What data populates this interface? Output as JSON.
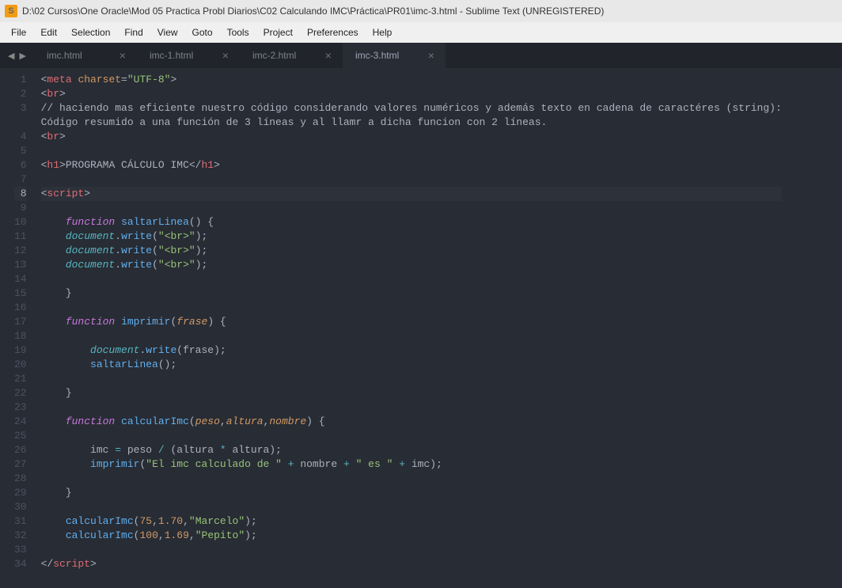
{
  "title": "D:\\02 Cursos\\One Oracle\\Mod 05 Practica Probl Diarios\\C02 Calculando IMC\\Práctica\\PR01\\imc-3.html - Sublime Text (UNREGISTERED)",
  "menu": [
    "File",
    "Edit",
    "Selection",
    "Find",
    "View",
    "Goto",
    "Tools",
    "Project",
    "Preferences",
    "Help"
  ],
  "nav": {
    "back": "◀",
    "forward": "▶"
  },
  "tabs": [
    {
      "label": "imc.html",
      "active": false
    },
    {
      "label": "imc-1.html",
      "active": false
    },
    {
      "label": "imc-2.html",
      "active": false
    },
    {
      "label": "imc-3.html",
      "active": true
    }
  ],
  "close_glyph": "×",
  "active_line": 8,
  "code": [
    {
      "n": 1,
      "seg": [
        [
          "<",
          "p-grey"
        ],
        [
          "meta ",
          "p-red"
        ],
        [
          "charset",
          "p-orange"
        ],
        [
          "=",
          "p-grey"
        ],
        [
          "\"UTF-8\"",
          "p-green"
        ],
        [
          ">",
          "p-grey"
        ]
      ]
    },
    {
      "n": 2,
      "seg": [
        [
          "<",
          "p-grey"
        ],
        [
          "br",
          "p-red"
        ],
        [
          ">",
          "p-grey"
        ]
      ]
    },
    {
      "n": 3,
      "seg": [
        [
          "// haciendo mas eficiente nuestro código considerando valores numéricos y además texto en cadena de caractéres (string):",
          "p-grey"
        ]
      ]
    },
    {
      "n": 0,
      "seg": [
        [
          "Código resumido a una función de 3 líneas y al llamr a dicha funcion con 2 líneas.",
          "p-grey"
        ]
      ]
    },
    {
      "n": 4,
      "seg": [
        [
          "<",
          "p-grey"
        ],
        [
          "br",
          "p-red"
        ],
        [
          ">",
          "p-grey"
        ]
      ]
    },
    {
      "n": 5,
      "seg": [
        [
          "",
          "p-grey"
        ]
      ]
    },
    {
      "n": 6,
      "seg": [
        [
          "<",
          "p-grey"
        ],
        [
          "h1",
          "p-red"
        ],
        [
          ">",
          "p-grey"
        ],
        [
          "PROGRAMA CÁLCULO IMC",
          "p-grey"
        ],
        [
          "</",
          "p-grey"
        ],
        [
          "h1",
          "p-red"
        ],
        [
          ">",
          "p-grey"
        ]
      ]
    },
    {
      "n": 7,
      "seg": [
        [
          "",
          "p-grey"
        ]
      ]
    },
    {
      "n": 8,
      "seg": [
        [
          "<",
          "p-grey"
        ],
        [
          "script",
          "p-red"
        ],
        [
          ">",
          "p-grey"
        ]
      ]
    },
    {
      "n": 9,
      "seg": [
        [
          "",
          "p-grey"
        ]
      ]
    },
    {
      "n": 10,
      "seg": [
        [
          "    ",
          "p-grey"
        ],
        [
          "function",
          "p-purple p-ital"
        ],
        [
          " ",
          "p-grey"
        ],
        [
          "saltarLinea",
          "p-blue"
        ],
        [
          "() {",
          "p-grey"
        ]
      ]
    },
    {
      "n": 11,
      "seg": [
        [
          "    ",
          "p-grey"
        ],
        [
          "document",
          "p-cyan p-ital"
        ],
        [
          ".",
          "p-grey"
        ],
        [
          "write",
          "p-blue"
        ],
        [
          "(",
          "p-grey"
        ],
        [
          "\"<br>\"",
          "p-green"
        ],
        [
          ");",
          "p-grey"
        ]
      ]
    },
    {
      "n": 12,
      "seg": [
        [
          "    ",
          "p-grey"
        ],
        [
          "document",
          "p-cyan p-ital"
        ],
        [
          ".",
          "p-grey"
        ],
        [
          "write",
          "p-blue"
        ],
        [
          "(",
          "p-grey"
        ],
        [
          "\"<br>\"",
          "p-green"
        ],
        [
          ");",
          "p-grey"
        ]
      ]
    },
    {
      "n": 13,
      "seg": [
        [
          "    ",
          "p-grey"
        ],
        [
          "document",
          "p-cyan p-ital"
        ],
        [
          ".",
          "p-grey"
        ],
        [
          "write",
          "p-blue"
        ],
        [
          "(",
          "p-grey"
        ],
        [
          "\"<br>\"",
          "p-green"
        ],
        [
          ");",
          "p-grey"
        ]
      ]
    },
    {
      "n": 14,
      "seg": [
        [
          "",
          "p-grey"
        ]
      ]
    },
    {
      "n": 15,
      "seg": [
        [
          "    }",
          "p-grey"
        ]
      ]
    },
    {
      "n": 16,
      "seg": [
        [
          "",
          "p-grey"
        ]
      ]
    },
    {
      "n": 17,
      "seg": [
        [
          "    ",
          "p-grey"
        ],
        [
          "function",
          "p-purple p-ital"
        ],
        [
          " ",
          "p-grey"
        ],
        [
          "imprimir",
          "p-blue"
        ],
        [
          "(",
          "p-grey"
        ],
        [
          "frase",
          "p-orange p-ital"
        ],
        [
          ") {",
          "p-grey"
        ]
      ]
    },
    {
      "n": 18,
      "seg": [
        [
          "",
          "p-grey"
        ]
      ]
    },
    {
      "n": 19,
      "seg": [
        [
          "        ",
          "p-grey"
        ],
        [
          "document",
          "p-cyan p-ital"
        ],
        [
          ".",
          "p-grey"
        ],
        [
          "write",
          "p-blue"
        ],
        [
          "(frase);",
          "p-grey"
        ]
      ]
    },
    {
      "n": 20,
      "seg": [
        [
          "        ",
          "p-grey"
        ],
        [
          "saltarLinea",
          "p-blue"
        ],
        [
          "();",
          "p-grey"
        ]
      ]
    },
    {
      "n": 21,
      "seg": [
        [
          "",
          "p-grey"
        ]
      ]
    },
    {
      "n": 22,
      "seg": [
        [
          "    }",
          "p-grey"
        ]
      ]
    },
    {
      "n": 23,
      "seg": [
        [
          "",
          "p-grey"
        ]
      ]
    },
    {
      "n": 24,
      "seg": [
        [
          "    ",
          "p-grey"
        ],
        [
          "function",
          "p-purple p-ital"
        ],
        [
          " ",
          "p-grey"
        ],
        [
          "calcularImc",
          "p-blue"
        ],
        [
          "(",
          "p-grey"
        ],
        [
          "peso",
          "p-orange p-ital"
        ],
        [
          ",",
          "p-grey"
        ],
        [
          "altura",
          "p-orange p-ital"
        ],
        [
          ",",
          "p-grey"
        ],
        [
          "nombre",
          "p-orange p-ital"
        ],
        [
          ") {",
          "p-grey"
        ]
      ]
    },
    {
      "n": 25,
      "seg": [
        [
          "",
          "p-grey"
        ]
      ]
    },
    {
      "n": 26,
      "seg": [
        [
          "        imc ",
          "p-grey"
        ],
        [
          "=",
          "p-cyan"
        ],
        [
          " peso ",
          "p-grey"
        ],
        [
          "/",
          "p-cyan"
        ],
        [
          " (altura ",
          "p-grey"
        ],
        [
          "*",
          "p-cyan"
        ],
        [
          " altura);",
          "p-grey"
        ]
      ]
    },
    {
      "n": 27,
      "seg": [
        [
          "        ",
          "p-grey"
        ],
        [
          "imprimir",
          "p-blue"
        ],
        [
          "(",
          "p-grey"
        ],
        [
          "\"El imc calculado de \"",
          "p-green"
        ],
        [
          " ",
          "p-grey"
        ],
        [
          "+",
          "p-cyan"
        ],
        [
          " nombre ",
          "p-grey"
        ],
        [
          "+",
          "p-cyan"
        ],
        [
          " ",
          "p-grey"
        ],
        [
          "\" es \"",
          "p-green"
        ],
        [
          " ",
          "p-grey"
        ],
        [
          "+",
          "p-cyan"
        ],
        [
          " imc);",
          "p-grey"
        ]
      ]
    },
    {
      "n": 28,
      "seg": [
        [
          "",
          "p-grey"
        ]
      ]
    },
    {
      "n": 29,
      "seg": [
        [
          "    }",
          "p-grey"
        ]
      ]
    },
    {
      "n": 30,
      "seg": [
        [
          "",
          "p-grey"
        ]
      ]
    },
    {
      "n": 31,
      "seg": [
        [
          "    ",
          "p-grey"
        ],
        [
          "calcularImc",
          "p-blue"
        ],
        [
          "(",
          "p-grey"
        ],
        [
          "75",
          "p-orange"
        ],
        [
          ",",
          "p-grey"
        ],
        [
          "1.70",
          "p-orange"
        ],
        [
          ",",
          "p-grey"
        ],
        [
          "\"Marcelo\"",
          "p-green"
        ],
        [
          ");",
          "p-grey"
        ]
      ]
    },
    {
      "n": 32,
      "seg": [
        [
          "    ",
          "p-grey"
        ],
        [
          "calcularImc",
          "p-blue"
        ],
        [
          "(",
          "p-grey"
        ],
        [
          "100",
          "p-orange"
        ],
        [
          ",",
          "p-grey"
        ],
        [
          "1.69",
          "p-orange"
        ],
        [
          ",",
          "p-grey"
        ],
        [
          "\"Pepito\"",
          "p-green"
        ],
        [
          ");",
          "p-grey"
        ]
      ]
    },
    {
      "n": 33,
      "seg": [
        [
          "",
          "p-grey"
        ]
      ]
    },
    {
      "n": 34,
      "seg": [
        [
          "</",
          "p-grey"
        ],
        [
          "script",
          "p-red"
        ],
        [
          ">",
          "p-grey"
        ]
      ]
    }
  ]
}
